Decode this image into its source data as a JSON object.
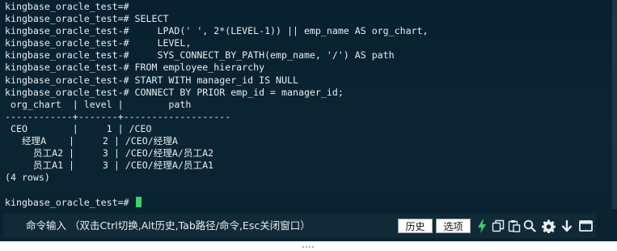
{
  "terminal": {
    "lines": [
      "kingbase_oracle_test=#",
      "kingbase_oracle_test=# SELECT",
      "kingbase_oracle_test-#     LPAD(' ', 2*(LEVEL-1)) || emp_name AS org_chart,",
      "kingbase_oracle_test-#     LEVEL,",
      "kingbase_oracle_test-#     SYS_CONNECT_BY_PATH(emp_name, '/') AS path",
      "kingbase_oracle_test-# FROM employee_hierarchy",
      "kingbase_oracle_test-# START WITH manager_id IS NULL",
      "kingbase_oracle_test-# CONNECT BY PRIOR emp_id = manager_id;",
      " org_chart  | level |        path",
      "------------+-------+-------------------",
      " CEO        |     1 | /CEO",
      "   经理A    |     2 | /CEO/经理A",
      "     员工A2 |     3 | /CEO/经理A/员工A2",
      "     员工A1 |     3 | /CEO/经理A/员工A1",
      "(4 rows)",
      "",
      "kingbase_oracle_test=# "
    ]
  },
  "command_bar": {
    "hint": "命令输入 （双击Ctrl切换,Alt历史,Tab路径/命令,Esc关闭窗口）",
    "history_label": "历史",
    "options_label": "选项",
    "icons": [
      "lightning-icon",
      "copy-icon",
      "paste-icon",
      "search-icon",
      "gear-icon",
      "download-icon",
      "window-icon"
    ]
  },
  "colors": {
    "terminal_bg": "#0a2533",
    "terminal_text": "#e6eef2",
    "cursor": "#3bd06a",
    "lightning": "#3bd06a",
    "command_bar_bg": "#102a38"
  }
}
